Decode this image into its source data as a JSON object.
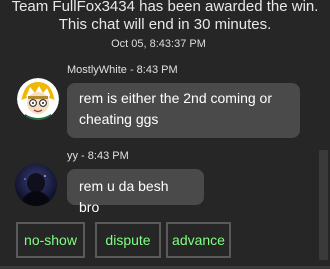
{
  "system": {
    "line1": "Team FullFox3434 has been awarded the win.",
    "line2": "This chat will end in 30 minutes.",
    "timestamp": "Oct 05, 8:43:37 PM"
  },
  "messages": [
    {
      "sender": "MostlyWhite - 8:43 PM",
      "text_line1": "rem is either the 2nd coming or",
      "text_line2": "cheating ggs",
      "avatar": "cartoon-character-avatar"
    },
    {
      "sender": "yy - 8:43 PM",
      "text": "rem u da besh bro",
      "avatar": "dark-hooded-figure-avatar"
    }
  ],
  "actions": {
    "no_show": "no-show",
    "dispute": "dispute",
    "advance": "advance"
  },
  "colors": {
    "background": "#262626",
    "bubble": "#4a4a4a",
    "action_text": "#7fff7f",
    "action_border": "#5a5a5a"
  }
}
